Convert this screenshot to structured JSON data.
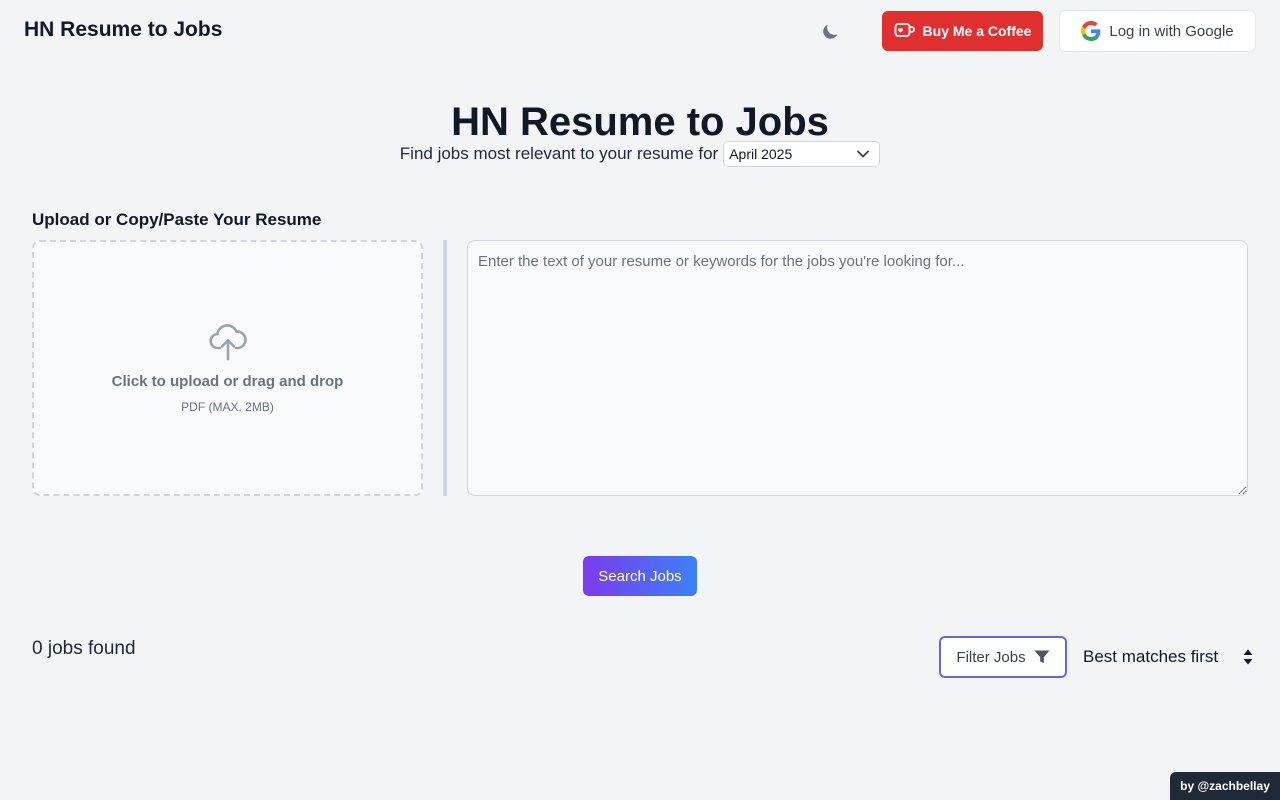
{
  "header": {
    "brand": "HN Resume to Jobs",
    "coffee_label": "Buy Me a Coffee",
    "google_label": "Log in with Google",
    "theme_icon": "moon-icon"
  },
  "hero": {
    "title": "HN Resume to Jobs",
    "subtitle": "Find jobs most relevant to your resume for",
    "month_selected": "April 2025"
  },
  "upload": {
    "section_label": "Upload or Copy/Paste Your Resume",
    "drop_title": "Click to upload or drag and drop",
    "drop_sub": "PDF (MAX. 2MB)",
    "icon": "cloud-upload-icon"
  },
  "resume": {
    "placeholder": "Enter the text of your resume or keywords for the jobs you're looking for...",
    "value": ""
  },
  "actions": {
    "search_label": "Search Jobs"
  },
  "results": {
    "jobs_found": "0 jobs found",
    "filter_label": "Filter Jobs",
    "sort_selected": "Best matches first"
  },
  "footer": {
    "credit": "by @zachbellay"
  },
  "colors": {
    "background": "#f3f4f6",
    "coffee_red": "#e02f2f",
    "accent_purple": "#7c3aed",
    "accent_blue": "#3b82f6",
    "filter_border": "#6366f1"
  }
}
